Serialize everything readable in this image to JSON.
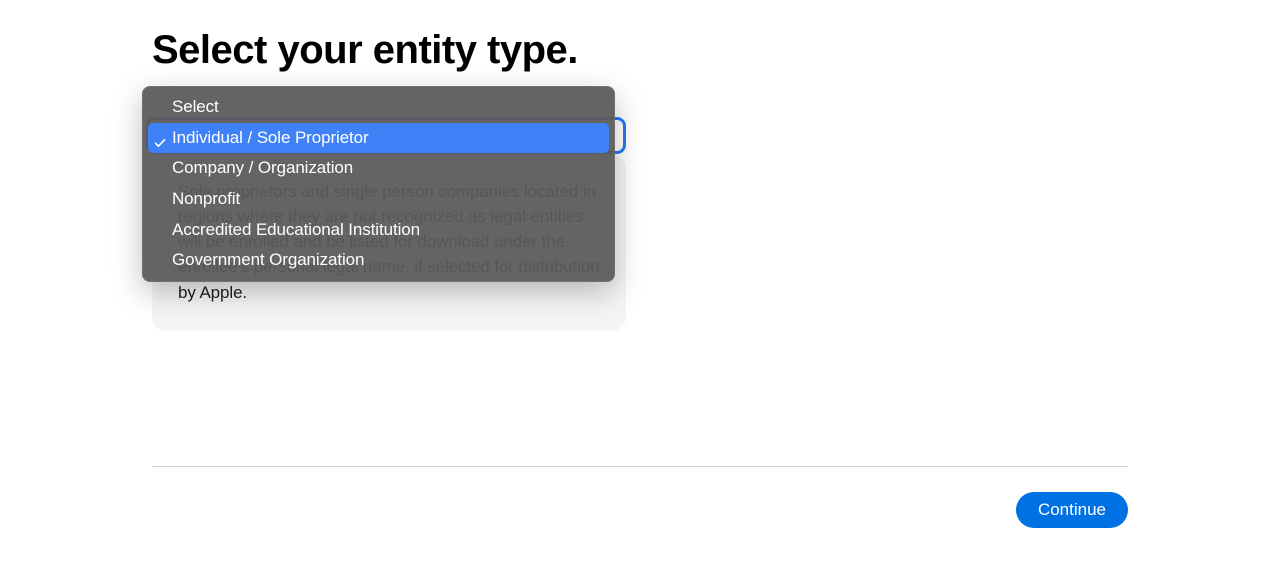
{
  "page": {
    "title": "Select your entity type."
  },
  "dropdown": {
    "options": [
      "Select",
      "Individual / Sole Proprietor",
      "Company / Organization",
      "Nonprofit",
      "Accredited Educational Institution",
      "Government Organization"
    ],
    "highlighted_index": 1
  },
  "info": {
    "text": "Sole proprietors and single person companies located in regions where they are not recognized as legal entities will be enrolled and be listed for download under the enrollee's personal legal name, if selected for distribution by Apple."
  },
  "footer": {
    "continue_label": "Continue"
  }
}
